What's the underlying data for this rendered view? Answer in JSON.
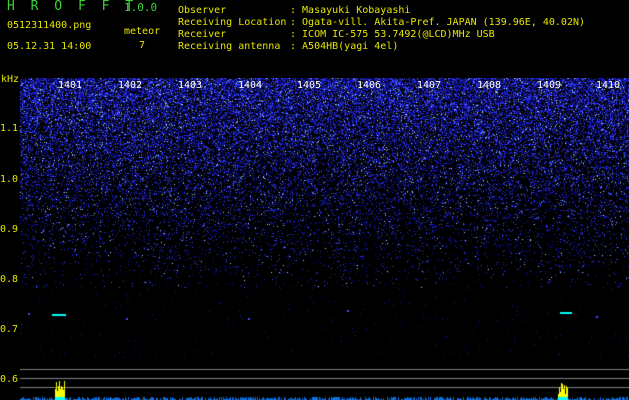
{
  "header": {
    "app_name": "H R O F F T",
    "version": "1.0.0",
    "file_name": "0512311400.png",
    "date_time": "05.12.31 14:00",
    "meteor_label": "meteor",
    "meteor_count": "7"
  },
  "metadata": [
    {
      "label": "Observer",
      "value": ": Masayuki Kobayashi"
    },
    {
      "label": "Receiving Location",
      "value": ": Ogata-vill. Akita-Pref. JAPAN (139.96E, 40.02N)"
    },
    {
      "label": "Receiver",
      "value": ": ICOM IC-575 53.7492(@LCD)MHz USB"
    },
    {
      "label": "Receiving antenna",
      "value": ": A504HB(yagi 4el)"
    }
  ],
  "spectrogram": {
    "y_unit": "kHz",
    "y_ticks": [
      "1.1",
      "1.0",
      "0.9",
      "0.8",
      "0.7",
      "0.6"
    ],
    "x_ticks": [
      "1401",
      "1402",
      "1403",
      "1404",
      "1405",
      "1406",
      "1407",
      "1408",
      "1409",
      "1410"
    ],
    "colors": {
      "background": "#000000",
      "noise": "#1a1aff",
      "signal": "#00ffff",
      "peak": "#ffff00",
      "label_yellow": "#e6e600",
      "label_green": "#3bd13b"
    }
  }
}
